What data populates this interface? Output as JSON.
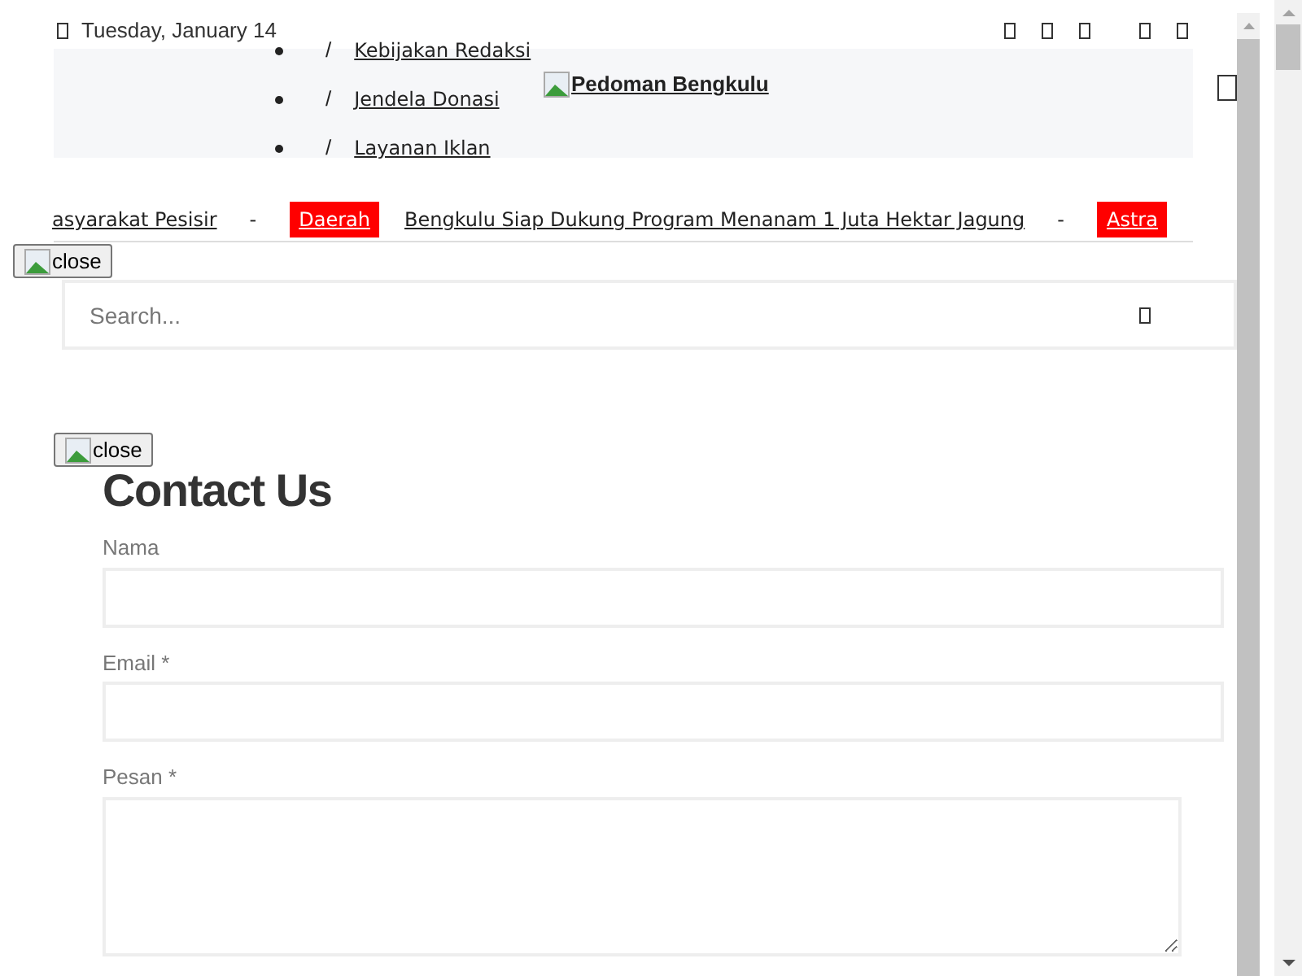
{
  "top_bar": {
    "date": "Tuesday, January 14",
    "menu": [
      {
        "separator": "/",
        "label": "Kebijakan Redaksi"
      },
      {
        "separator": "/",
        "label": "Jendela Donasi"
      },
      {
        "separator": "/",
        "label": "Layanan Iklan"
      }
    ],
    "logo_alt": "Pedoman Bengkulu"
  },
  "ticker": [
    {
      "kind": "link",
      "text": "asyarakat Pesisir"
    },
    {
      "kind": "separator",
      "text": "-"
    },
    {
      "kind": "tag",
      "text": "Daerah"
    },
    {
      "kind": "link",
      "text": "Bengkulu Siap Dukung Program Menanam 1 Juta Hektar Jagung"
    },
    {
      "kind": "separator",
      "text": "-"
    },
    {
      "kind": "tag",
      "text": "Astra"
    }
  ],
  "close_buttons": [
    "close",
    "close"
  ],
  "search": {
    "placeholder": "Search..."
  },
  "contact": {
    "title": "Contact Us",
    "fields": [
      {
        "kind": "input",
        "label": "Nama"
      },
      {
        "kind": "input",
        "label": "Email *"
      },
      {
        "kind": "textarea",
        "label": "Pesan *"
      }
    ]
  }
}
